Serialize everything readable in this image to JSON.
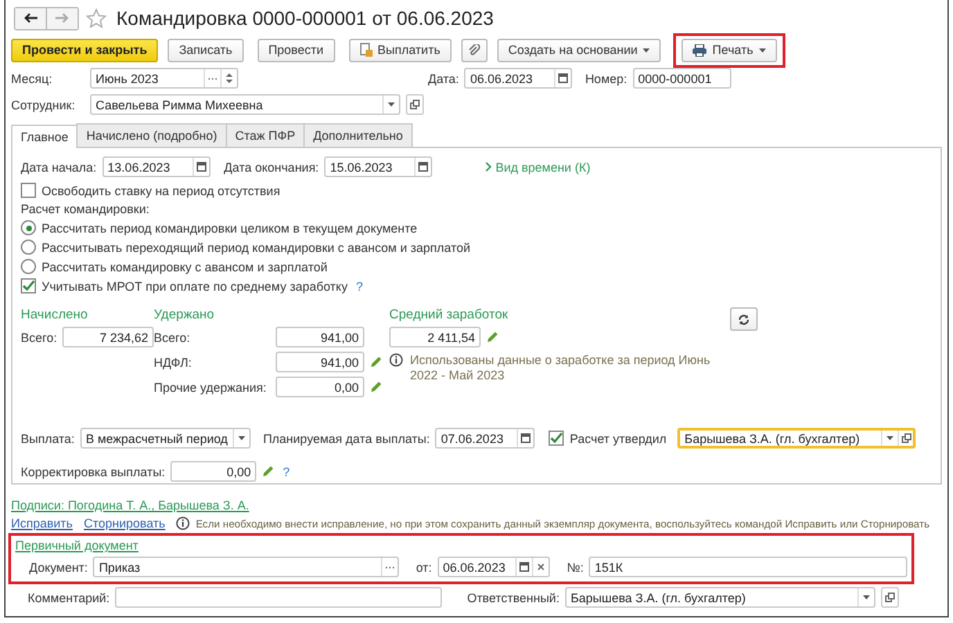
{
  "window": {
    "title": "Командировка 0000-000001 от 06.06.2023"
  },
  "toolbar": [
    {
      "kind": "primary",
      "label": "Провести и закрыть"
    },
    {
      "kind": "plain",
      "label": "Записать"
    },
    {
      "kind": "plain",
      "label": "Провести"
    },
    {
      "kind": "pay",
      "label": "Выплатить"
    },
    {
      "kind": "attach"
    },
    {
      "kind": "menu",
      "label": "Создать на основании"
    },
    {
      "kind": "print",
      "label": "Печать",
      "highlighted": true
    }
  ],
  "header": {
    "month_label": "Месяц:",
    "month": "Июнь 2023",
    "date_label": "Дата:",
    "date": "06.06.2023",
    "number_label": "Номер:",
    "number": "0000-000001",
    "employee_label": "Сотрудник:",
    "employee": "Савельева Римма Михеевна"
  },
  "tabs": [
    {
      "label": "Главное",
      "selected": true
    },
    {
      "label": "Начислено (подробно)",
      "selected": false
    },
    {
      "label": "Стаж ПФР",
      "selected": false
    },
    {
      "label": "Дополнительно",
      "selected": false
    }
  ],
  "main": {
    "start_label": "Дата начала:",
    "start": "13.06.2023",
    "end_label": "Дата окончания:",
    "end": "15.06.2023",
    "time_kind_link": "Вид времени (К)",
    "release_rate": {
      "label": "Освободить ставку на период отсутствия",
      "checked": false
    },
    "calc_label": "Расчет командировки:",
    "calc_options": [
      {
        "label": "Рассчитать период командировки целиком в текущем документе",
        "selected": true
      },
      {
        "label": "Рассчитывать переходящий период командировки с авансом и зарплатой",
        "selected": false
      },
      {
        "label": "Рассчитать командировку с авансом и зарплатой",
        "selected": false
      }
    ],
    "mrot": {
      "label": "Учитывать МРОТ при оплате по среднему заработку",
      "checked": true,
      "help": "?"
    },
    "accrued": {
      "title": "Начислено",
      "total_label": "Всего:",
      "total": "7 234,62"
    },
    "withheld": {
      "title": "Удержано",
      "rows": [
        {
          "label": "Всего:",
          "value": "941,00",
          "editable": false
        },
        {
          "label": "НДФЛ:",
          "value": "941,00",
          "editable": true
        },
        {
          "label": "Прочие удержания:",
          "value": "0,00",
          "editable": true
        }
      ]
    },
    "average": {
      "title": "Средний заработок",
      "value": "2 411,54",
      "editable": true,
      "note": "Использованы данные о заработке за период Июнь 2022 - Май 2023"
    },
    "payment": {
      "label": "Выплата:",
      "value": "В межрасчетный период",
      "planned_label": "Планируемая дата выплаты:",
      "planned": "07.06.2023"
    },
    "approved": {
      "label": "Расчет утвердил",
      "checked": true,
      "value": "Барышева З.А. (гл. бухгалтер)",
      "focused": true
    },
    "correction": {
      "label": "Корректировка выплаты:",
      "value": "0,00",
      "editable": true,
      "help": "?"
    }
  },
  "signatures_link": "Подписи: Погодина Т. А., Барышева З. А.",
  "corrections": {
    "links": [
      "Исправить",
      "Сторнировать"
    ],
    "info": "Если необходимо внести исправление, но при этом сохранить данный экземпляр документа, воспользуйтесь командой Исправить или Сторнировать"
  },
  "primary_document": {
    "title": "Первичный документ",
    "highlighted": true,
    "doc_label": "Документ:",
    "doc": "Приказ",
    "from_label": "от:",
    "date": "06.06.2023",
    "number_label": "№:",
    "number": "151К"
  },
  "footer": {
    "comment_label": "Комментарий:",
    "responsible_label": "Ответственный:",
    "responsible": "Барышева З.А. (гл. бухгалтер)"
  }
}
